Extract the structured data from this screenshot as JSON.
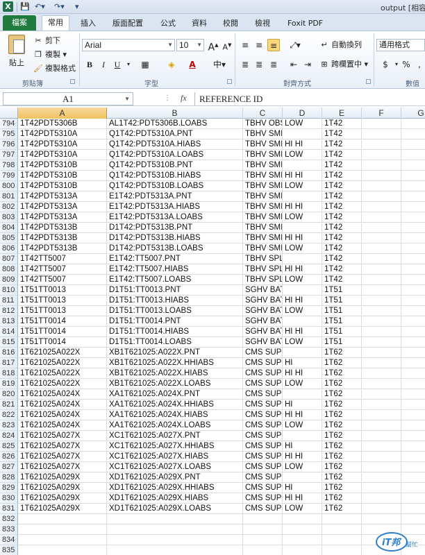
{
  "window": {
    "title": "output [相容",
    "app_icon": "X"
  },
  "quick_access": {
    "save_icon": "save-icon",
    "undo_icon": "undo-icon",
    "redo_icon": "redo-icon"
  },
  "ribbon": {
    "file_tab": "檔案",
    "tabs": [
      "常用",
      "插入",
      "版面配置",
      "公式",
      "資料",
      "校閱",
      "檢視",
      "Foxit PDF"
    ],
    "clipboard": {
      "paste": "貼上",
      "cut": "剪下",
      "copy": "複製",
      "format_painter": "複製格式",
      "group_label": "剪貼簿"
    },
    "font": {
      "font_name": "Arial",
      "font_size": "10",
      "bold": "B",
      "italic": "I",
      "underline": "U",
      "grow": "A",
      "shrink": "A",
      "group_label": "字型"
    },
    "alignment": {
      "wrap_text": "自動換列",
      "merge_center": "跨欄置中",
      "group_label": "對齊方式"
    },
    "number": {
      "format": "通用格式",
      "currency": "$",
      "percent": "%",
      "group_label": "數值"
    }
  },
  "formula_bar": {
    "name_box": "A1",
    "fx": "fx",
    "content": "REFERENCE ID"
  },
  "columns": [
    "A",
    "B",
    "C",
    "D",
    "E",
    "F",
    "G"
  ],
  "rows": [
    {
      "n": "794",
      "a": "1T42PDT5306B",
      "b": "AL1T42:PDT5306B.LOABS",
      "c": "TBHV OBS",
      "d": "LOW",
      "e": "1T42"
    },
    {
      "n": "795",
      "a": "1T42PDT5310A",
      "b": "Q1T42:PDT5310A.PNT",
      "c": "TBHV SMI",
      "d": "",
      "e": "1T42"
    },
    {
      "n": "796",
      "a": "1T42PDT5310A",
      "b": "Q1T42:PDT5310A.HIABS",
      "c": "TBHV SMI",
      "d": "HI HI",
      "e": "1T42"
    },
    {
      "n": "797",
      "a": "1T42PDT5310A",
      "b": "Q1T42:PDT5310A.LOABS",
      "c": "TBHV SMI",
      "d": "LOW",
      "e": "1T42"
    },
    {
      "n": "798",
      "a": "1T42PDT5310B",
      "b": "Q1T42:PDT5310B.PNT",
      "c": "TBHV SMI",
      "d": "",
      "e": "1T42"
    },
    {
      "n": "799",
      "a": "1T42PDT5310B",
      "b": "Q1T42:PDT5310B.HIABS",
      "c": "TBHV SMI",
      "d": "HI HI",
      "e": "1T42"
    },
    {
      "n": "800",
      "a": "1T42PDT5310B",
      "b": "Q1T42:PDT5310B.LOABS",
      "c": "TBHV SMI",
      "d": "LOW",
      "e": "1T42"
    },
    {
      "n": "801",
      "a": "1T42PDT5313A",
      "b": "E1T42:PDT5313A.PNT",
      "c": "TBHV SMI",
      "d": "",
      "e": "1T42"
    },
    {
      "n": "802",
      "a": "1T42PDT5313A",
      "b": "E1T42:PDT5313A.HIABS",
      "c": "TBHV SMI",
      "d": "HI HI",
      "e": "1T42"
    },
    {
      "n": "803",
      "a": "1T42PDT5313A",
      "b": "E1T42:PDT5313A.LOABS",
      "c": "TBHV SMI",
      "d": "LOW",
      "e": "1T42"
    },
    {
      "n": "804",
      "a": "1T42PDT5313B",
      "b": "D1T42:PDT5313B.PNT",
      "c": "TBHV SMI",
      "d": "",
      "e": "1T42"
    },
    {
      "n": "805",
      "a": "1T42PDT5313B",
      "b": "D1T42:PDT5313B.HIABS",
      "c": "TBHV SMI",
      "d": "HI HI",
      "e": "1T42"
    },
    {
      "n": "806",
      "a": "1T42PDT5313B",
      "b": "D1T42:PDT5313B.LOABS",
      "c": "TBHV SMI",
      "d": "LOW",
      "e": "1T42"
    },
    {
      "n": "807",
      "a": "1T42TT5007",
      "b": "E1T42:TT5007.PNT",
      "c": "TBHV SPL",
      "d": "",
      "e": "1T42"
    },
    {
      "n": "808",
      "a": "1T42TT5007",
      "b": "E1T42:TT5007.HIABS",
      "c": "TBHV SPL",
      "d": "HI HI",
      "e": "1T42"
    },
    {
      "n": "809",
      "a": "1T42TT5007",
      "b": "E1T42:TT5007.LOABS",
      "c": "TBHV SPL",
      "d": "LOW",
      "e": "1T42"
    },
    {
      "n": "810",
      "a": "1T51TT0013",
      "b": "D1T51:TT0013.PNT",
      "c": "SGHV BAT",
      "d": "",
      "e": "1T51"
    },
    {
      "n": "811",
      "a": "1T51TT0013",
      "b": "D1T51:TT0013.HIABS",
      "c": "SGHV BAT",
      "d": "HI HI",
      "e": "1T51"
    },
    {
      "n": "812",
      "a": "1T51TT0013",
      "b": "D1T51:TT0013.LOABS",
      "c": "SGHV BAT",
      "d": "LOW",
      "e": "1T51"
    },
    {
      "n": "813",
      "a": "1T51TT0014",
      "b": "D1T51:TT0014.PNT",
      "c": "SGHV BAT",
      "d": "",
      "e": "1T51"
    },
    {
      "n": "814",
      "a": "1T51TT0014",
      "b": "D1T51:TT0014.HIABS",
      "c": "SGHV BAT",
      "d": "HI HI",
      "e": "1T51"
    },
    {
      "n": "815",
      "a": "1T51TT0014",
      "b": "D1T51:TT0014.LOABS",
      "c": "SGHV BAT",
      "d": "LOW",
      "e": "1T51"
    },
    {
      "n": "816",
      "a": "1T621025A022X",
      "b": "XB1T621025:A022X.PNT",
      "c": "CMS SUP",
      "d": "",
      "e": "1T62"
    },
    {
      "n": "817",
      "a": "1T621025A022X",
      "b": "XB1T621025:A022X.HHIABS",
      "c": "CMS SUP",
      "d": "HI",
      "e": "1T62"
    },
    {
      "n": "818",
      "a": "1T621025A022X",
      "b": "XB1T621025:A022X.HIABS",
      "c": "CMS SUP",
      "d": "HI HI",
      "e": "1T62"
    },
    {
      "n": "819",
      "a": "1T621025A022X",
      "b": "XB1T621025:A022X.LOABS",
      "c": "CMS SUP",
      "d": "LOW",
      "e": "1T62"
    },
    {
      "n": "820",
      "a": "1T621025A024X",
      "b": "XA1T621025:A024X.PNT",
      "c": "CMS SUP",
      "d": "",
      "e": "1T62"
    },
    {
      "n": "821",
      "a": "1T621025A024X",
      "b": "XA1T621025:A024X.HHIABS",
      "c": "CMS SUP",
      "d": "HI",
      "e": "1T62"
    },
    {
      "n": "822",
      "a": "1T621025A024X",
      "b": "XA1T621025:A024X.HIABS",
      "c": "CMS SUP",
      "d": "HI HI",
      "e": "1T62"
    },
    {
      "n": "823",
      "a": "1T621025A024X",
      "b": "XA1T621025:A024X.LOABS",
      "c": "CMS SUP",
      "d": "LOW",
      "e": "1T62"
    },
    {
      "n": "824",
      "a": "1T621025A027X",
      "b": "XC1T621025:A027X.PNT",
      "c": "CMS SUP",
      "d": "",
      "e": "1T62"
    },
    {
      "n": "825",
      "a": "1T621025A027X",
      "b": "XC1T621025:A027X.HHIABS",
      "c": "CMS SUP",
      "d": "HI",
      "e": "1T62"
    },
    {
      "n": "826",
      "a": "1T621025A027X",
      "b": "XC1T621025:A027X.HIABS",
      "c": "CMS SUP",
      "d": "HI HI",
      "e": "1T62"
    },
    {
      "n": "827",
      "a": "1T621025A027X",
      "b": "XC1T621025:A027X.LOABS",
      "c": "CMS SUP",
      "d": "LOW",
      "e": "1T62"
    },
    {
      "n": "828",
      "a": "1T621025A029X",
      "b": "XD1T621025:A029X.PNT",
      "c": "CMS SUP",
      "d": "",
      "e": "1T62"
    },
    {
      "n": "829",
      "a": "1T621025A029X",
      "b": "XD1T621025:A029X.HHIABS",
      "c": "CMS SUP",
      "d": "HI",
      "e": "1T62"
    },
    {
      "n": "830",
      "a": "1T621025A029X",
      "b": "XD1T621025:A029X.HIABS",
      "c": "CMS SUP",
      "d": "HI HI",
      "e": "1T62"
    },
    {
      "n": "831",
      "a": "1T621025A029X",
      "b": "XD1T621025:A029X.LOABS",
      "c": "CMS SUP",
      "d": "LOW",
      "e": "1T62"
    },
    {
      "n": "832",
      "a": "",
      "b": "",
      "c": "",
      "d": "",
      "e": ""
    },
    {
      "n": "833",
      "a": "",
      "b": "",
      "c": "",
      "d": "",
      "e": ""
    },
    {
      "n": "834",
      "a": "",
      "b": "",
      "c": "",
      "d": "",
      "e": ""
    },
    {
      "n": "835",
      "a": "",
      "b": "",
      "c": "",
      "d": "",
      "e": ""
    }
  ],
  "watermark": {
    "text": "iT邦",
    "sub": "幫忙"
  },
  "colors": {
    "file_tab": "#1f7a3e",
    "selected_header": "#f1c15f",
    "ribbon_bg": "#dbe5f1"
  }
}
